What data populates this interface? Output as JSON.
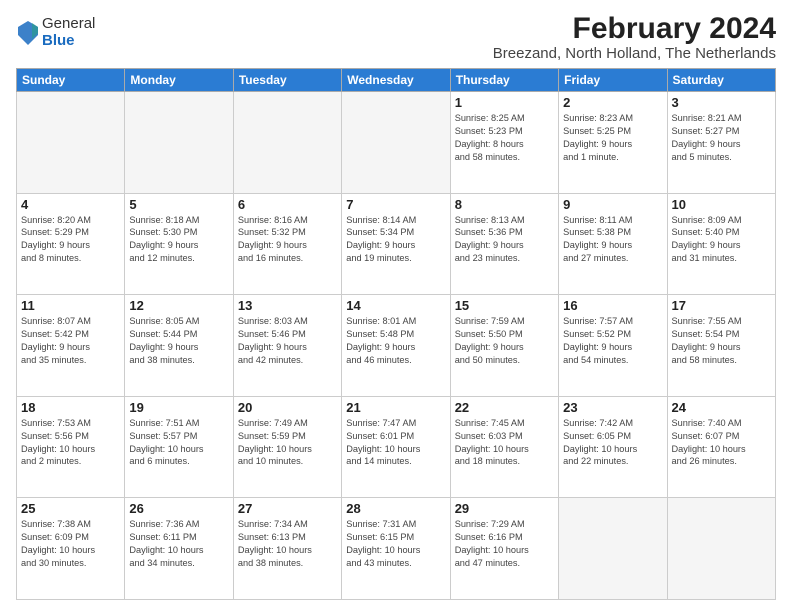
{
  "header": {
    "logo_general": "General",
    "logo_blue": "Blue",
    "title": "February 2024",
    "subtitle": "Breezand, North Holland, The Netherlands"
  },
  "columns": [
    "Sunday",
    "Monday",
    "Tuesday",
    "Wednesday",
    "Thursday",
    "Friday",
    "Saturday"
  ],
  "weeks": [
    [
      {
        "day": "",
        "info": ""
      },
      {
        "day": "",
        "info": ""
      },
      {
        "day": "",
        "info": ""
      },
      {
        "day": "",
        "info": ""
      },
      {
        "day": "1",
        "info": "Sunrise: 8:25 AM\nSunset: 5:23 PM\nDaylight: 8 hours\nand 58 minutes."
      },
      {
        "day": "2",
        "info": "Sunrise: 8:23 AM\nSunset: 5:25 PM\nDaylight: 9 hours\nand 1 minute."
      },
      {
        "day": "3",
        "info": "Sunrise: 8:21 AM\nSunset: 5:27 PM\nDaylight: 9 hours\nand 5 minutes."
      }
    ],
    [
      {
        "day": "4",
        "info": "Sunrise: 8:20 AM\nSunset: 5:29 PM\nDaylight: 9 hours\nand 8 minutes."
      },
      {
        "day": "5",
        "info": "Sunrise: 8:18 AM\nSunset: 5:30 PM\nDaylight: 9 hours\nand 12 minutes."
      },
      {
        "day": "6",
        "info": "Sunrise: 8:16 AM\nSunset: 5:32 PM\nDaylight: 9 hours\nand 16 minutes."
      },
      {
        "day": "7",
        "info": "Sunrise: 8:14 AM\nSunset: 5:34 PM\nDaylight: 9 hours\nand 19 minutes."
      },
      {
        "day": "8",
        "info": "Sunrise: 8:13 AM\nSunset: 5:36 PM\nDaylight: 9 hours\nand 23 minutes."
      },
      {
        "day": "9",
        "info": "Sunrise: 8:11 AM\nSunset: 5:38 PM\nDaylight: 9 hours\nand 27 minutes."
      },
      {
        "day": "10",
        "info": "Sunrise: 8:09 AM\nSunset: 5:40 PM\nDaylight: 9 hours\nand 31 minutes."
      }
    ],
    [
      {
        "day": "11",
        "info": "Sunrise: 8:07 AM\nSunset: 5:42 PM\nDaylight: 9 hours\nand 35 minutes."
      },
      {
        "day": "12",
        "info": "Sunrise: 8:05 AM\nSunset: 5:44 PM\nDaylight: 9 hours\nand 38 minutes."
      },
      {
        "day": "13",
        "info": "Sunrise: 8:03 AM\nSunset: 5:46 PM\nDaylight: 9 hours\nand 42 minutes."
      },
      {
        "day": "14",
        "info": "Sunrise: 8:01 AM\nSunset: 5:48 PM\nDaylight: 9 hours\nand 46 minutes."
      },
      {
        "day": "15",
        "info": "Sunrise: 7:59 AM\nSunset: 5:50 PM\nDaylight: 9 hours\nand 50 minutes."
      },
      {
        "day": "16",
        "info": "Sunrise: 7:57 AM\nSunset: 5:52 PM\nDaylight: 9 hours\nand 54 minutes."
      },
      {
        "day": "17",
        "info": "Sunrise: 7:55 AM\nSunset: 5:54 PM\nDaylight: 9 hours\nand 58 minutes."
      }
    ],
    [
      {
        "day": "18",
        "info": "Sunrise: 7:53 AM\nSunset: 5:56 PM\nDaylight: 10 hours\nand 2 minutes."
      },
      {
        "day": "19",
        "info": "Sunrise: 7:51 AM\nSunset: 5:57 PM\nDaylight: 10 hours\nand 6 minutes."
      },
      {
        "day": "20",
        "info": "Sunrise: 7:49 AM\nSunset: 5:59 PM\nDaylight: 10 hours\nand 10 minutes."
      },
      {
        "day": "21",
        "info": "Sunrise: 7:47 AM\nSunset: 6:01 PM\nDaylight: 10 hours\nand 14 minutes."
      },
      {
        "day": "22",
        "info": "Sunrise: 7:45 AM\nSunset: 6:03 PM\nDaylight: 10 hours\nand 18 minutes."
      },
      {
        "day": "23",
        "info": "Sunrise: 7:42 AM\nSunset: 6:05 PM\nDaylight: 10 hours\nand 22 minutes."
      },
      {
        "day": "24",
        "info": "Sunrise: 7:40 AM\nSunset: 6:07 PM\nDaylight: 10 hours\nand 26 minutes."
      }
    ],
    [
      {
        "day": "25",
        "info": "Sunrise: 7:38 AM\nSunset: 6:09 PM\nDaylight: 10 hours\nand 30 minutes."
      },
      {
        "day": "26",
        "info": "Sunrise: 7:36 AM\nSunset: 6:11 PM\nDaylight: 10 hours\nand 34 minutes."
      },
      {
        "day": "27",
        "info": "Sunrise: 7:34 AM\nSunset: 6:13 PM\nDaylight: 10 hours\nand 38 minutes."
      },
      {
        "day": "28",
        "info": "Sunrise: 7:31 AM\nSunset: 6:15 PM\nDaylight: 10 hours\nand 43 minutes."
      },
      {
        "day": "29",
        "info": "Sunrise: 7:29 AM\nSunset: 6:16 PM\nDaylight: 10 hours\nand 47 minutes."
      },
      {
        "day": "",
        "info": ""
      },
      {
        "day": "",
        "info": ""
      }
    ]
  ]
}
